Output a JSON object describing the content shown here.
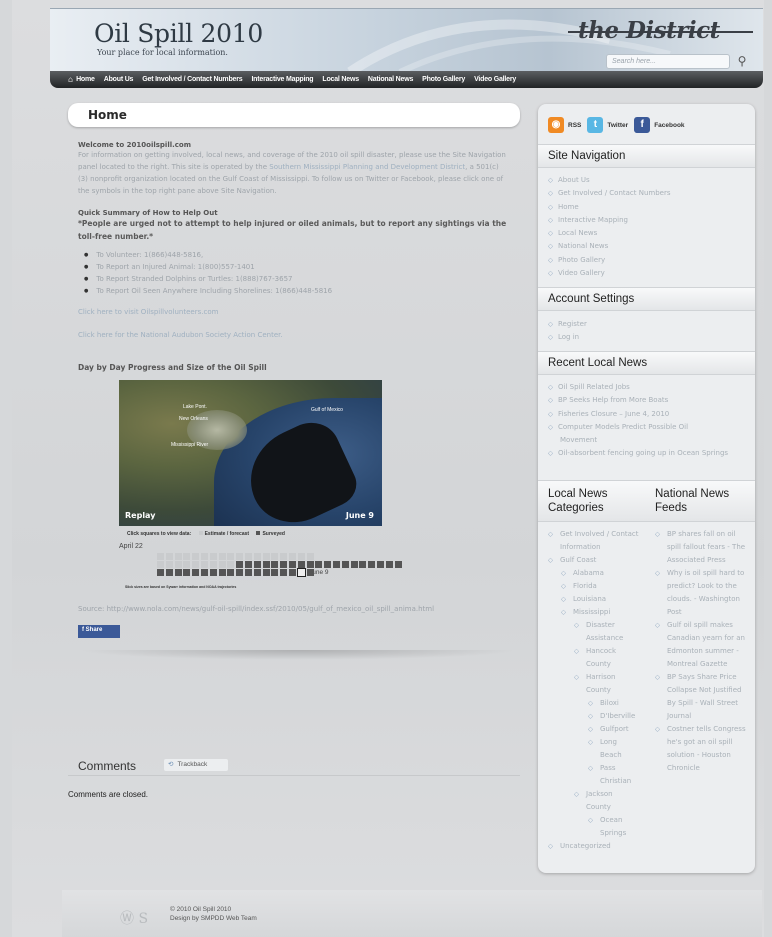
{
  "header": {
    "title": "Oil Spill 2010",
    "tagline": "Your place for local information.",
    "brand": "the District",
    "search_placeholder": "Search here..."
  },
  "nav": [
    "Home",
    "About Us",
    "Get Involved / Contact Numbers",
    "Interactive Mapping",
    "Local News",
    "National News",
    "Photo Gallery",
    "Video Gallery"
  ],
  "main": {
    "title": "Home",
    "welcome_heading": "Welcome to 2010oilspill.com",
    "intro_a": "For information on getting involved, local news, and coverage of the 2010 oil spill disaster, please use the Site Navigation panel located to the right. This site is operated by the ",
    "intro_link": "Southern Mississippi Planning and Development District",
    "intro_b": ", a 501(c)(3) nonprofit organization located on the Gulf Coast of Mississippi. To follow us on Twitter or Facebook, please click one of the symbols in the top right pane above Site Navigation.",
    "summary_heading": "Quick Summary of How to Help Out",
    "warning": "*People are urged not to attempt to help injured or oiled animals, but to report any sightings via the toll-free number.*",
    "bullets": [
      "To Volunteer: 1(866)448-5816,",
      "To Report an Injured Animal: 1(800)557-1401",
      "To Report Stranded Dolphins or Turtles: 1(888)767-3657",
      "To Report Oil Seen Anywhere Including Shorelines: 1(866)448-5816"
    ],
    "link_volunteer": "Click here to visit Oilspillvolunteers.com",
    "link_audubon": "Click here for the National Audubon Society Action Center.",
    "map_title": "Day by Day Progress and Size of the Oil Spill",
    "map": {
      "replay": "Replay",
      "date": "June 9",
      "label_gulf": "Gulf of Mexico",
      "label_lake": "Lake Pont.",
      "label_new_orleans": "New Orleans",
      "label_barataria": "Mississippi River",
      "legend_click": "Click squares to view data:",
      "legend_estimate": "Estimate / forecast",
      "legend_surveyed": "Surveyed",
      "grid_start": "April 22",
      "grid_end": "June 9",
      "grid_note": "Slick sizes are based on Sywarr information and NOAA trajectories"
    },
    "source_label": "Source: http://www.nola.com/news/gulf-oil-spill/index.ssf/2010/05/gulf_of_mexico_oil_spill_anima.html",
    "share": "Share",
    "comments_title": "Comments",
    "trackback": "Trackback",
    "comments_closed": "Comments are closed."
  },
  "sidebar": {
    "social": [
      "RSS",
      "Twitter",
      "Facebook"
    ],
    "site_nav_title": "Site Navigation",
    "site_nav": [
      "About Us",
      "Get Involved / Contact Numbers",
      "Home",
      "Interactive Mapping",
      "Local News",
      "National News",
      "Photo Gallery",
      "Video Gallery"
    ],
    "account_title": "Account Settings",
    "account": [
      "Register",
      "Log in"
    ],
    "recent_title": "Recent Local News",
    "recent": [
      "Oil Spill Related Jobs",
      "BP Seeks Help from More Boats",
      "Fisheries Closure – June 4, 2010",
      "Computer Models Predict Possible Oil Movement",
      "Oil-absorbent fencing going up in Ocean Springs"
    ],
    "categories_title": "Local News Categories",
    "national_title": "National News Feeds",
    "categories": {
      "get_involved": "Get Involved / Contact Information",
      "gulf_coast": "Gulf Coast",
      "alabama": "Alabama",
      "florida": "Florida",
      "louisiana": "Louisiana",
      "mississippi": "Mississippi",
      "disaster": "Disaster Assistance",
      "hancock": "Hancock County",
      "harrison": "Harrison County",
      "biloxi": "Biloxi",
      "diberville": "D'Iberville",
      "gulfport": "Gulfport",
      "long_beach": "Long Beach",
      "pass_christian": "Pass Christian",
      "jackson": "Jackson County",
      "ocean_springs": "Ocean Springs",
      "uncategorized": "Uncategorized"
    },
    "national": [
      "BP shares fall on oil spill fallout fears - The Associated Press",
      "Why is oil spill hard to predict? Look to the clouds. - Washington Post",
      "Gulf oil spill makes Canadian yearn for an Edmonton summer - Montreal Gazette",
      "BP Says Share Price Collapse Not Justified By Spill - Wall Street Journal",
      "Costner tells Congress he's got an oil spill solution - Houston Chronicle"
    ]
  },
  "footer": {
    "copyright": "© 2010 Oil Spill 2010",
    "design": "Design by SMPDD Web Team"
  }
}
